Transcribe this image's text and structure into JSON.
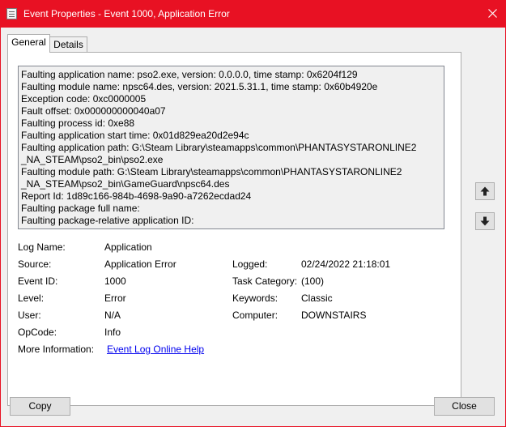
{
  "window": {
    "title": "Event Properties - Event 1000, Application Error"
  },
  "tabs": [
    {
      "label": "General"
    },
    {
      "label": "Details"
    }
  ],
  "description_lines": [
    "Faulting application name: pso2.exe, version: 0.0.0.0, time stamp: 0x6204f129",
    "Faulting module name: npsc64.des, version: 2021.5.31.1, time stamp: 0x60b4920e",
    "Exception code: 0xc0000005",
    "Fault offset: 0x000000000040a07",
    "Faulting process id: 0xe88",
    "Faulting application start time: 0x01d829ea20d2e94c",
    "Faulting application path: G:\\Steam Library\\steamapps\\common\\PHANTASYSTARONLINE2",
    "_NA_STEAM\\pso2_bin\\pso2.exe",
    "Faulting module path: G:\\Steam Library\\steamapps\\common\\PHANTASYSTARONLINE2",
    "_NA_STEAM\\pso2_bin\\GameGuard\\npsc64.des",
    "Report Id: 1d89c166-984b-4698-9a90-a7262ecdad24",
    "Faulting package full name:",
    "Faulting package-relative application ID:"
  ],
  "fields": {
    "log_name": {
      "label": "Log Name:",
      "value": "Application"
    },
    "source": {
      "label": "Source:",
      "value": "Application Error"
    },
    "logged": {
      "label": "Logged:",
      "value": "02/24/2022 21:18:01"
    },
    "event_id": {
      "label": "Event ID:",
      "value": "1000"
    },
    "task_category": {
      "label": "Task Category:",
      "value": "(100)"
    },
    "level": {
      "label": "Level:",
      "value": "Error"
    },
    "keywords": {
      "label": "Keywords:",
      "value": "Classic"
    },
    "user": {
      "label": "User:",
      "value": "N/A"
    },
    "computer": {
      "label": "Computer:",
      "value": "DOWNSTAIRS"
    },
    "opcode": {
      "label": "OpCode:",
      "value": "Info"
    },
    "more_info": {
      "label": "More Information:",
      "link": "Event Log Online Help"
    }
  },
  "buttons": {
    "copy": "Copy",
    "close": "Close"
  },
  "icons": {
    "close": "close-icon",
    "app": "event-properties-icon",
    "up": "arrow-up-icon",
    "down": "arrow-down-icon"
  },
  "colors": {
    "titlebar": "#e81123",
    "link": "#0000ee"
  }
}
